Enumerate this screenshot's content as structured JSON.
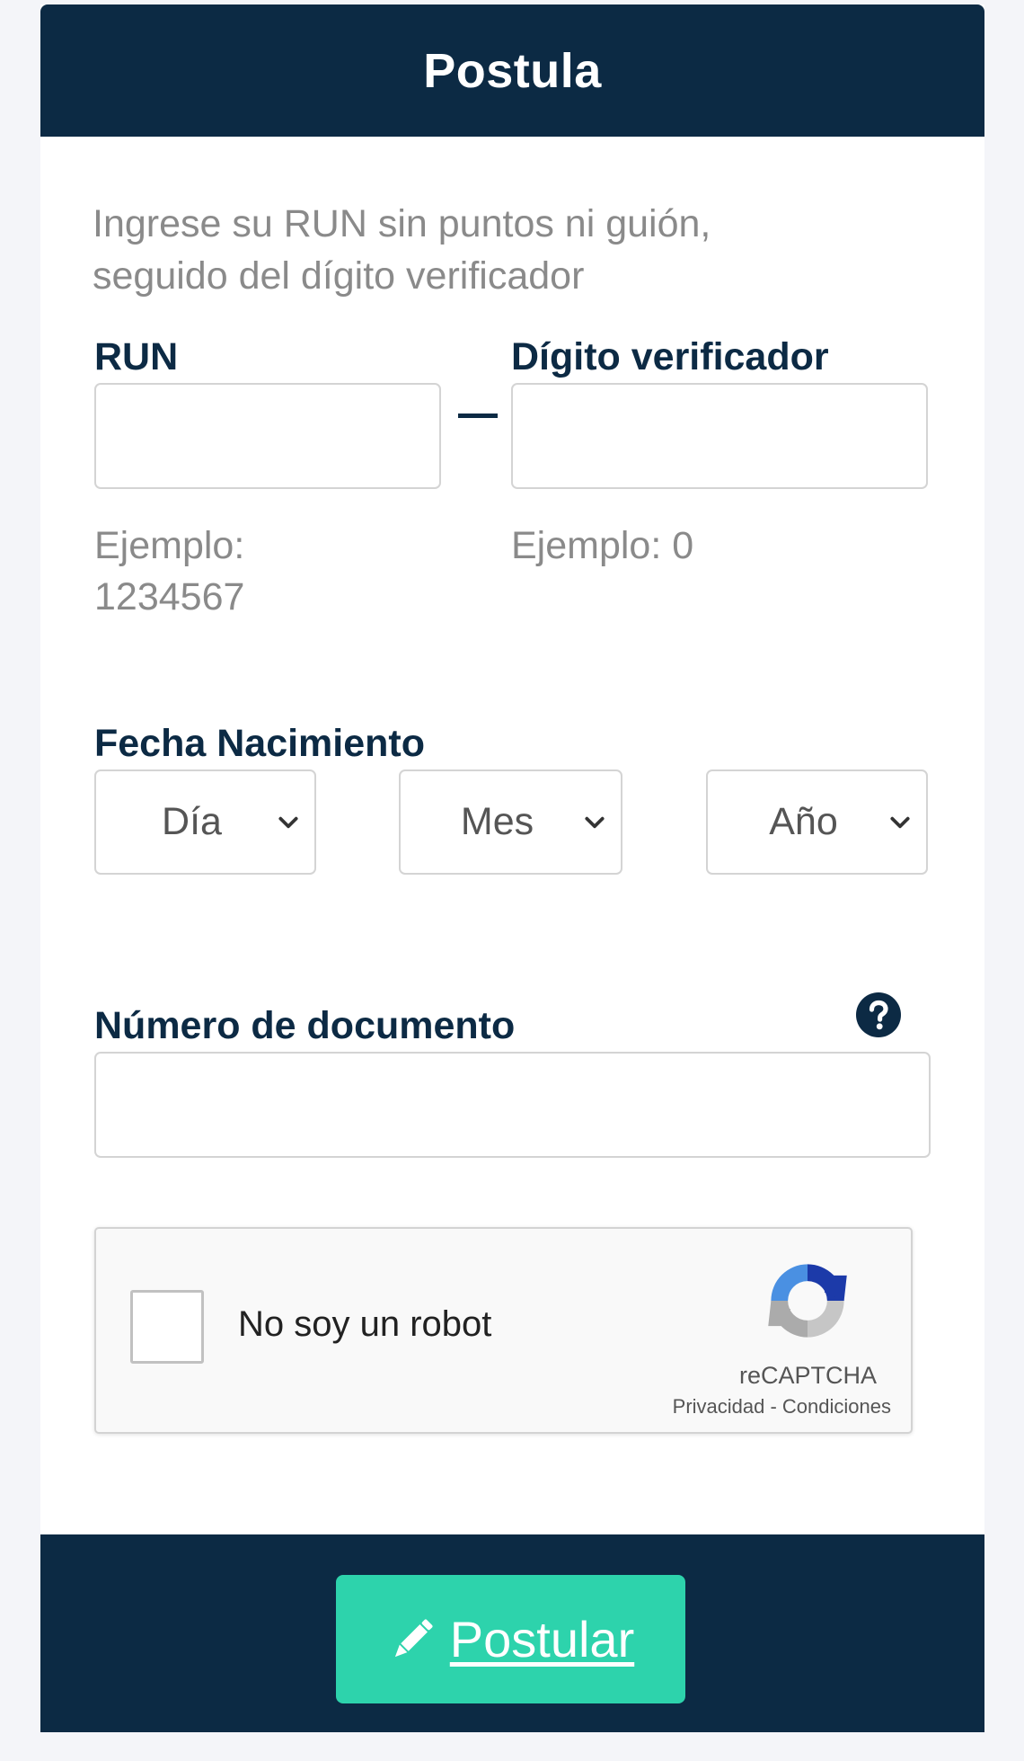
{
  "header": {
    "title": "Postula"
  },
  "instructions": {
    "line1": "Ingrese su RUN sin puntos ni guión,",
    "line2": "seguido del dígito verificador"
  },
  "run": {
    "label": "RUN",
    "value": "",
    "hint_line1": "Ejemplo:",
    "hint_line2": "1234567"
  },
  "dv": {
    "label": "Dígito verificador",
    "value": "",
    "hint": "Ejemplo: 0"
  },
  "birthdate": {
    "label": "Fecha Nacimiento",
    "day": "Día",
    "month": "Mes",
    "year": "Año"
  },
  "document": {
    "label": "Número de documento",
    "value": "",
    "help_icon": "question-circle-icon"
  },
  "captcha": {
    "label": "No soy un robot",
    "brand": "reCAPTCHA",
    "links": "Privacidad - Condiciones",
    "icon": "recaptcha-logo-icon"
  },
  "footer": {
    "submit_label": "Postular",
    "submit_icon": "pencil-icon"
  },
  "colors": {
    "primary": "#0c2a44",
    "accent": "#2dd3ac",
    "muted_text": "#8a8a8a",
    "page_bg": "#f4f5f9"
  }
}
